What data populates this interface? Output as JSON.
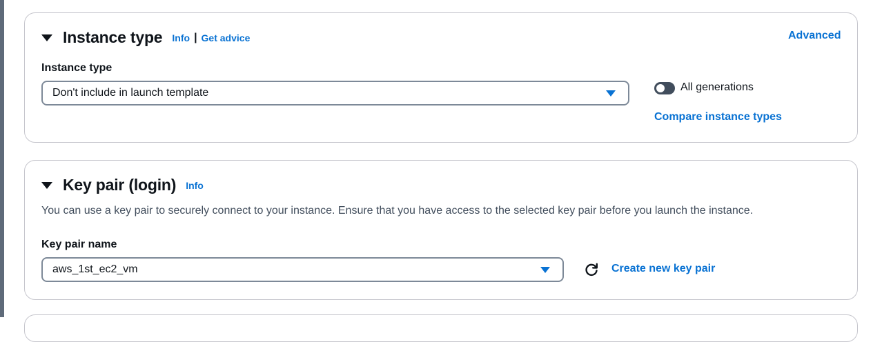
{
  "instance_type_section": {
    "title": "Instance type",
    "info_link": "Info",
    "separator": "|",
    "get_advice_link": "Get advice",
    "advanced_link": "Advanced",
    "field_label": "Instance type",
    "select_value": "Don't include in launch template",
    "toggle_label": "All generations",
    "compare_link": "Compare instance types"
  },
  "key_pair_section": {
    "title": "Key pair (login)",
    "info_link": "Info",
    "description": "You can use a key pair to securely connect to your instance. Ensure that you have access to the selected key pair before you launch the instance.",
    "field_label": "Key pair name",
    "select_value": "aws_1st_ec2_vm",
    "create_link": "Create new key pair"
  },
  "icons": {
    "section_caret": "caret-down-icon",
    "select_caret": "caret-down-filled-icon",
    "refresh": "refresh-icon"
  },
  "colors": {
    "link": "#0972d3",
    "text": "#0f141a",
    "border": "#c6c6cd",
    "toggle_off": "#414d5c"
  }
}
